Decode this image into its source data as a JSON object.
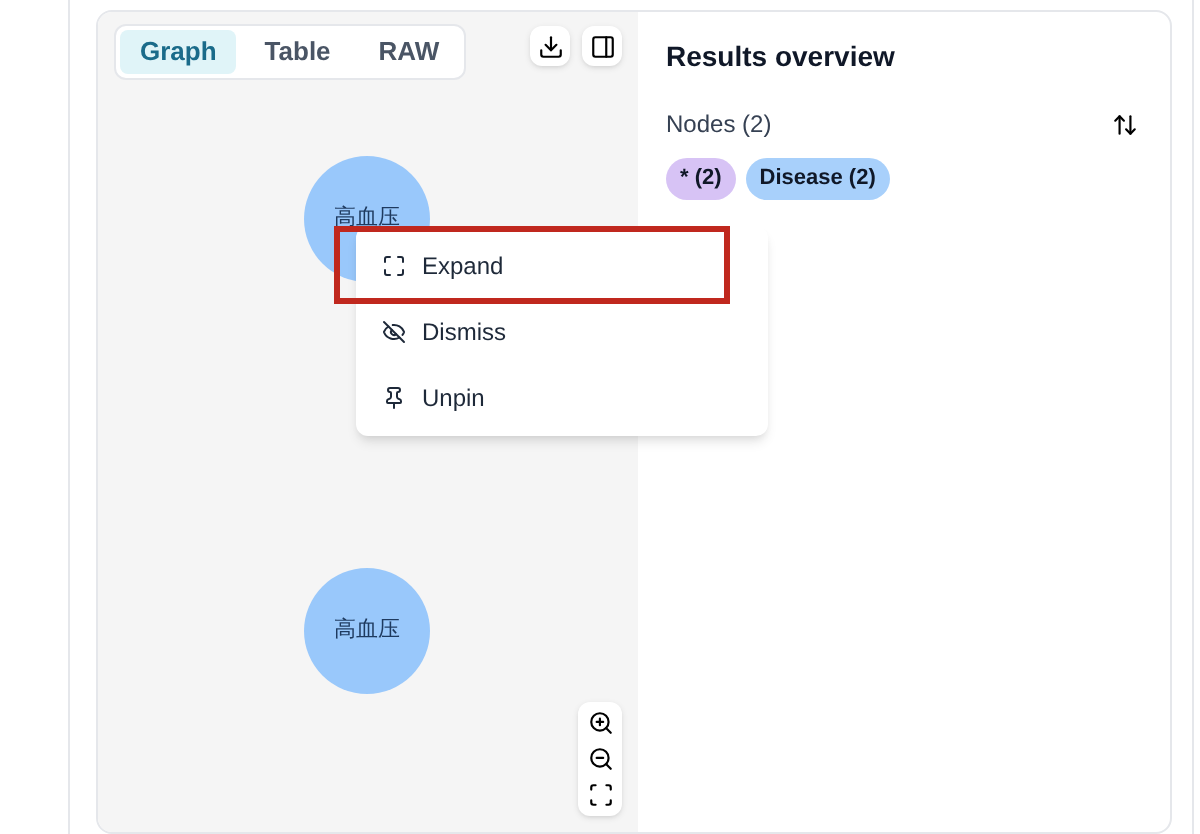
{
  "view_tabs": [
    {
      "label": "Graph",
      "selected": true
    },
    {
      "label": "Table",
      "selected": false
    },
    {
      "label": "RAW",
      "selected": false
    }
  ],
  "nodes": [
    {
      "label": "高血压"
    },
    {
      "label": "高血压"
    }
  ],
  "context_menu": {
    "items": [
      {
        "label": "Expand",
        "kind": "expand",
        "highlighted": true
      },
      {
        "label": "Dismiss",
        "kind": "dismiss",
        "highlighted": false
      },
      {
        "label": "Unpin",
        "kind": "unpin",
        "highlighted": false
      }
    ]
  },
  "results": {
    "title": "Results overview",
    "nodes_heading": "Nodes (2)",
    "labels": [
      {
        "label": "* (2)",
        "color": "#d7c3f5"
      },
      {
        "label": "Disease (2)",
        "color": "#a8d0fb"
      }
    ]
  }
}
